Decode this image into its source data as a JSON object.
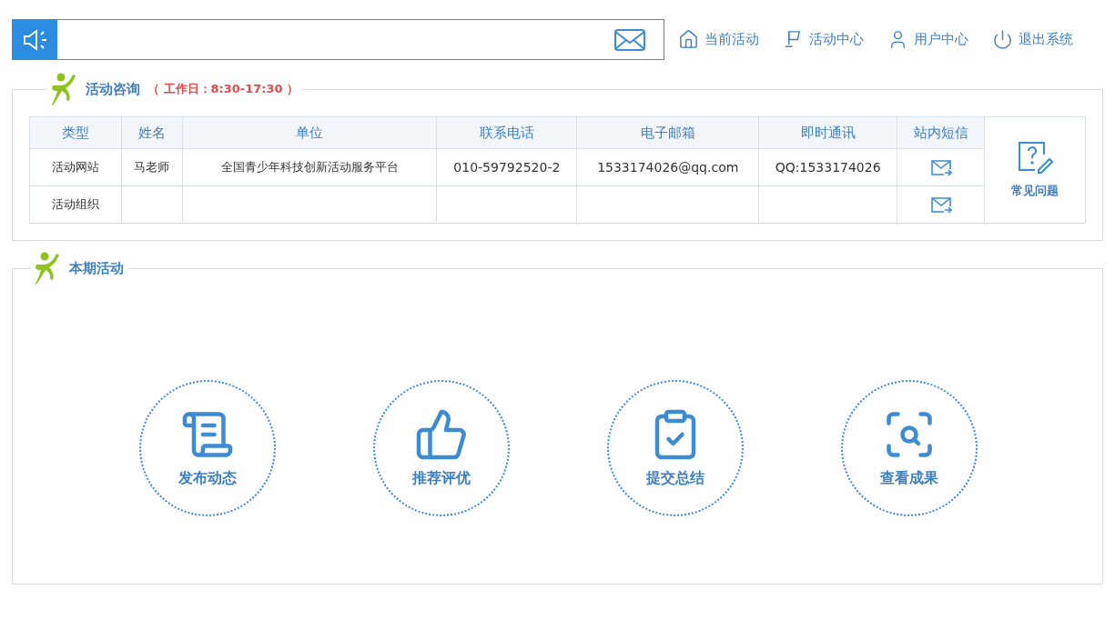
{
  "nav": [
    {
      "label": "当前活动",
      "kind": "home"
    },
    {
      "label": "活动中心",
      "kind": "flag"
    },
    {
      "label": "用户中心",
      "kind": "user"
    },
    {
      "label": "退出系统",
      "kind": "power"
    }
  ],
  "consult": {
    "title": "活动咨询",
    "hours": "（ 工作日：8:30-17:30 ）",
    "table": {
      "columns": [
        "类型",
        "姓名",
        "单位",
        "联系电话",
        "电子邮箱",
        "即时通讯",
        "站内短信"
      ],
      "rows": [
        {
          "cells": [
            "活动网站",
            "马老师",
            "全国青少年科技创新活动服务平台",
            "010-59792520-2",
            "1533174026@qq.com",
            "QQ:1533174026"
          ]
        },
        {
          "cells": [
            "活动组织"
          ]
        }
      ]
    },
    "faq": "常见问题"
  },
  "current": {
    "title": "本期活动",
    "actions": [
      {
        "label": "发布动态",
        "kind": "scroll"
      },
      {
        "label": "推荐评优",
        "kind": "thumb"
      },
      {
        "label": "提交总结",
        "kind": "clipboard"
      },
      {
        "label": "查看成果",
        "kind": "scan"
      }
    ]
  }
}
